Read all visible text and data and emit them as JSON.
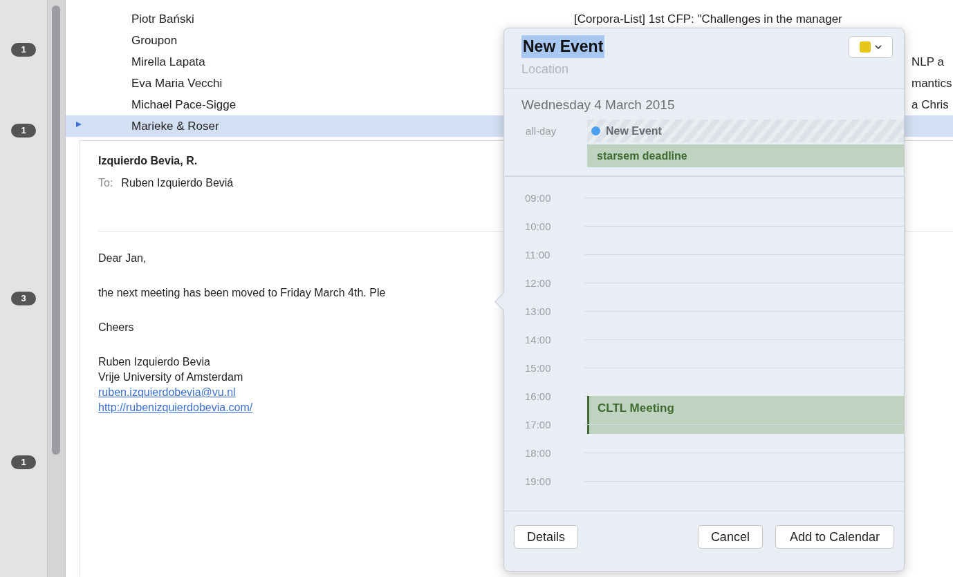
{
  "sidebar": {
    "badges": [
      "1",
      "1",
      "3",
      "1"
    ]
  },
  "message_list": {
    "rows": [
      {
        "sender": "Piotr Bański",
        "subject": "[Corpora-List] 1st CFP: \"Challenges in the manager",
        "selected": false
      },
      {
        "sender": "Groupon",
        "selected": false
      },
      {
        "sender": "Mirella Lapata",
        "subject_tail": "NLP a",
        "selected": false
      },
      {
        "sender": "Eva Maria Vecchi",
        "subject_tail": "mantics",
        "selected": false
      },
      {
        "sender": "Michael Pace-Sigge",
        "subject_tail": "a Chris",
        "selected": false
      },
      {
        "sender": "Marieke & Roser",
        "selected": true
      }
    ]
  },
  "message": {
    "from": "Izquierdo Bevia, R.",
    "to_label": "To:",
    "to": "Ruben Izquierdo Beviá",
    "paragraphs": [
      {
        "lines": [
          {
            "text": "Dear Jan,",
            "kind": "text"
          }
        ]
      },
      {
        "lines": [
          {
            "text": "the next meeting has been moved to Friday March 4th. Ple",
            "kind": "text"
          }
        ]
      },
      {
        "lines": [
          {
            "text": "Cheers",
            "kind": "text"
          }
        ]
      },
      {
        "lines": [
          {
            "text": "Ruben Izquierdo Bevia",
            "kind": "text"
          },
          {
            "text": "Vrije University of Amsterdam",
            "kind": "text"
          },
          {
            "text": "ruben.izquierdobevia@vu.nl",
            "kind": "link"
          },
          {
            "text": "http://rubenizquierdobevia.com/",
            "kind": "link"
          }
        ]
      }
    ]
  },
  "event_popover": {
    "title": "New Event",
    "title_highlighted": true,
    "location_placeholder": "Location",
    "date": "Wednesday 4 March 2015",
    "all_day_label": "all-day",
    "all_day_events": [
      {
        "title": "New Event",
        "kind": "new",
        "color": "#4a9ff0"
      },
      {
        "title": "starsem deadline",
        "kind": "event",
        "color": "#bfd4c0"
      }
    ],
    "hours": [
      {
        "label": "09:00"
      },
      {
        "label": "10:00"
      },
      {
        "label": "11:00"
      },
      {
        "label": "12:00"
      },
      {
        "label": "13:00"
      },
      {
        "label": "14:00"
      },
      {
        "label": "15:00"
      },
      {
        "label": "16:00",
        "events": [
          {
            "title": "CLTL Meeting",
            "color": "#bfd4c0"
          }
        ]
      },
      {
        "label": "17:00"
      },
      {
        "label": "18:00"
      },
      {
        "label": "19:00"
      }
    ],
    "buttons": {
      "details": "Details",
      "cancel": "Cancel",
      "add": "Add to Calendar"
    }
  }
}
